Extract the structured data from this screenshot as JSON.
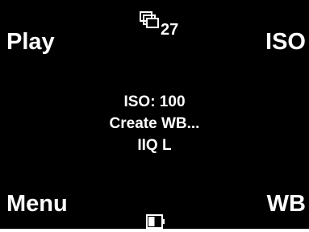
{
  "soft_keys": {
    "top_left": "Play",
    "top_right": "ISO",
    "bottom_left": "Menu",
    "bottom_right": "WB"
  },
  "counter": {
    "icon": "image-stack-icon",
    "value": "27"
  },
  "status": {
    "iso": "ISO: 100",
    "white_balance": "Create WB...",
    "file_format": "IIQ L"
  },
  "battery": {
    "icon": "battery-icon",
    "level": 0.5
  },
  "colors": {
    "screen_background": "#000000",
    "text": "#ffffff"
  }
}
